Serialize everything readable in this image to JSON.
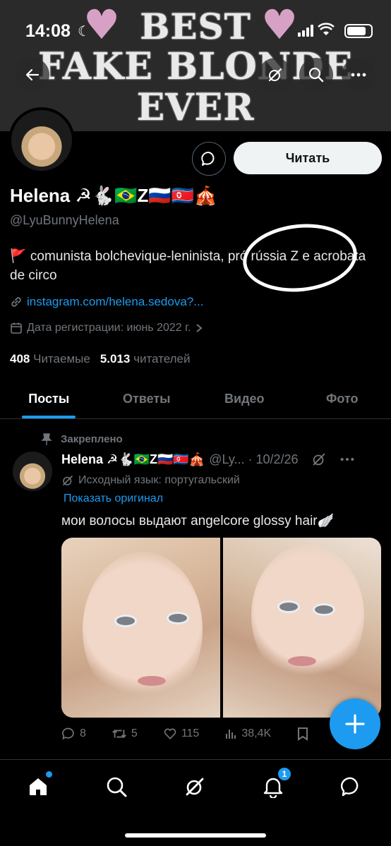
{
  "status_bar": {
    "time": "14:08"
  },
  "banner": {
    "line1": "BEST",
    "line2": "FAKE BLONDE",
    "line3": "EVER"
  },
  "profile": {
    "follow_label": "Читать",
    "display_name": "Helena ☭🐇🇧🇷Z🇷🇺🇰🇵🎪",
    "handle": "@LyuBunnyHelena",
    "bio": "🚩 comunista bolchevique-leninista, pró rússia Z e acrobata de circo",
    "link": "instagram.com/helena.sedova?...",
    "joined": "Дата регистрации: июнь 2022 г.",
    "following_count": "408",
    "following_label": "Читаемые",
    "followers_count": "5.013",
    "followers_label": "читателей"
  },
  "tabs": [
    {
      "label": "Посты",
      "active": true
    },
    {
      "label": "Ответы",
      "active": false
    },
    {
      "label": "Видео",
      "active": false
    },
    {
      "label": "Фото",
      "active": false
    }
  ],
  "tweet": {
    "pinned_label": "Закреплено",
    "name": "Helena ☭🐇🇧🇷Z🇷🇺🇰🇵🎪",
    "meta": "@Ly... · 10/2/26",
    "source_lang": "Исходный язык: португальский",
    "show_original": "Показать оригинал",
    "text": "мои волосы выдают angelcore glossy hair🪽",
    "replies": "8",
    "retweets": "5",
    "likes": "115",
    "views": "38,4K"
  },
  "bottom_nav": {
    "notifications_badge": "1"
  },
  "colors": {
    "accent": "#1d9bf0",
    "muted": "#71767b",
    "background": "#000000"
  }
}
